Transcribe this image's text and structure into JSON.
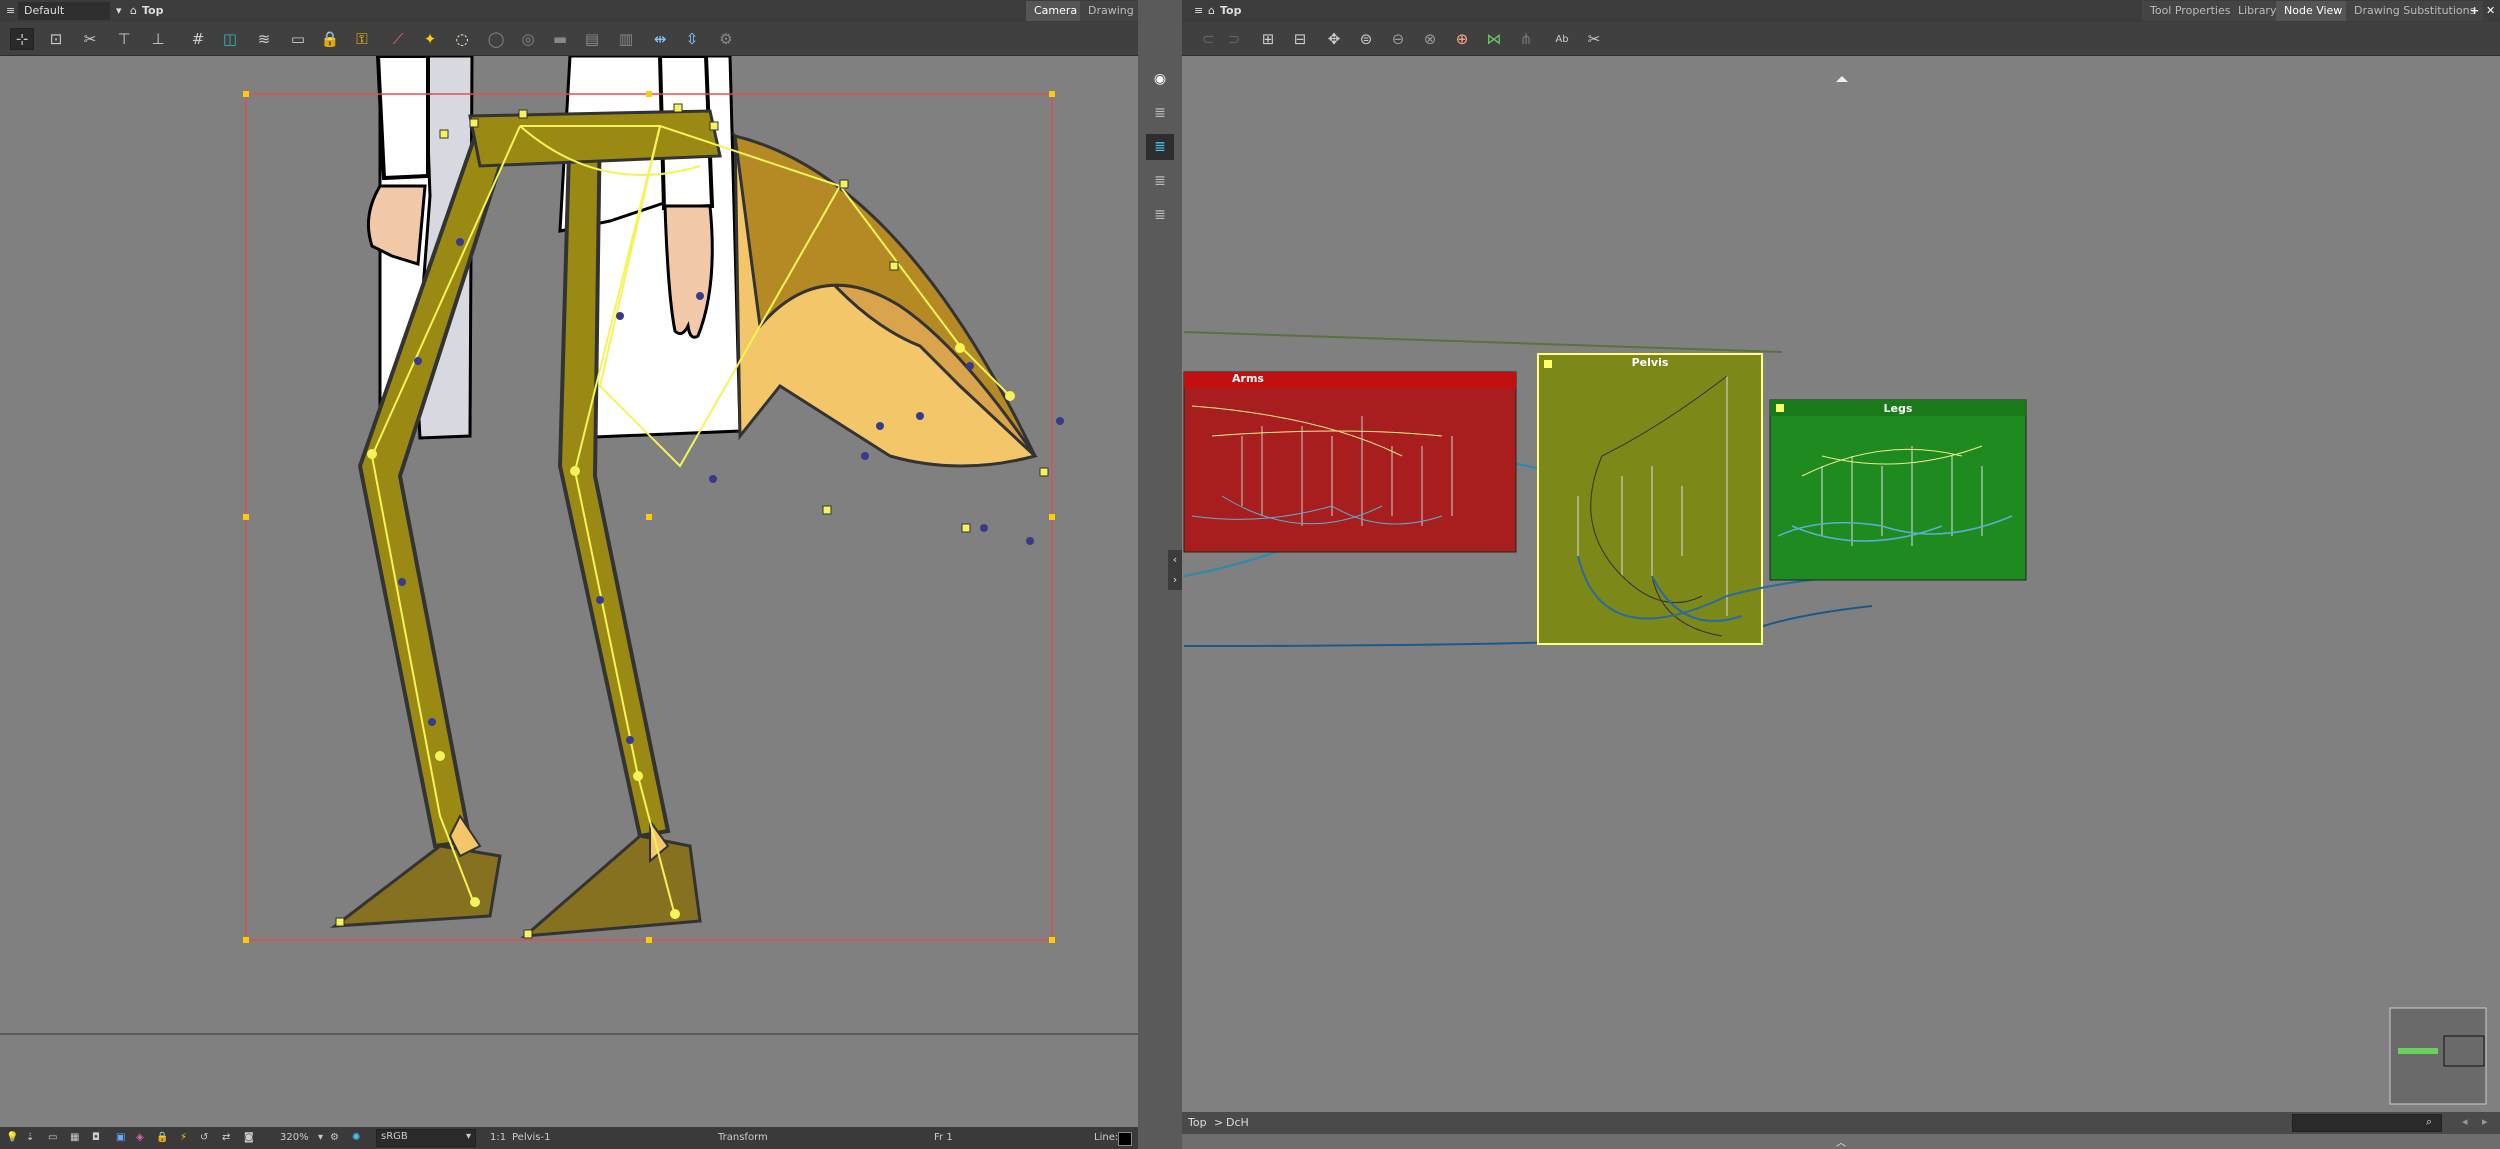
{
  "left_view": {
    "title": "Default (Display)",
    "context": "Top",
    "tabs": [
      "Camera",
      "Drawing"
    ],
    "zoom": "320%",
    "color_space": "sRGB",
    "ratio": "1:1",
    "selection": "Pelvis-1",
    "mode": "Transform",
    "frame": "Fr 1",
    "line_label": "Line:"
  },
  "right_view": {
    "context": "Top",
    "tabs": [
      "Tool Properties",
      "Library",
      "Node View",
      "Drawing Substitutions"
    ],
    "active_tab": "Node View",
    "breadcrumb": [
      "Top",
      ">",
      "DcH"
    ],
    "nodes": [
      {
        "name": "Arms",
        "color": "#b01818"
      },
      {
        "name": "Pelvis",
        "color": "#7c8818"
      },
      {
        "name": "Legs",
        "color": "#1f8a1f"
      }
    ]
  },
  "colors": {
    "leg_fill": "#9a8a14",
    "skirt_fill": "#f4c66a",
    "skirt_shade": "#d9a44c",
    "shoe_fill": "#857120",
    "coat": "#ffffff",
    "skin": "#f2c9a8",
    "selection_box": "#e05050",
    "handle": "#ffdd00",
    "bone": "#f4f45a"
  },
  "icons": {
    "left_toolbar": [
      "select-icon",
      "lock-icon",
      "cut-icon",
      "add-icon",
      "add-point-icon",
      "grid-icon",
      "display-icon",
      "onion-icon",
      "layer-icon",
      "lock-layer-icon",
      "lock-other-icon",
      "ruler-icon",
      "pivot-icon",
      "light-icon",
      "camera-icon",
      "hide-icon",
      "layers-icon",
      "flip-h-icon",
      "flip-v-icon",
      "settings-icon"
    ],
    "right_toolbar": [
      "link-icon",
      "unlink-icon",
      "group-icon",
      "ungroup-icon",
      "move-icon",
      "stack-icon",
      "peg-icon",
      "peg2-icon",
      "peg3-icon",
      "deform-icon",
      "composite-icon",
      "branch-icon",
      "rename-icon",
      "cutter-icon"
    ]
  }
}
